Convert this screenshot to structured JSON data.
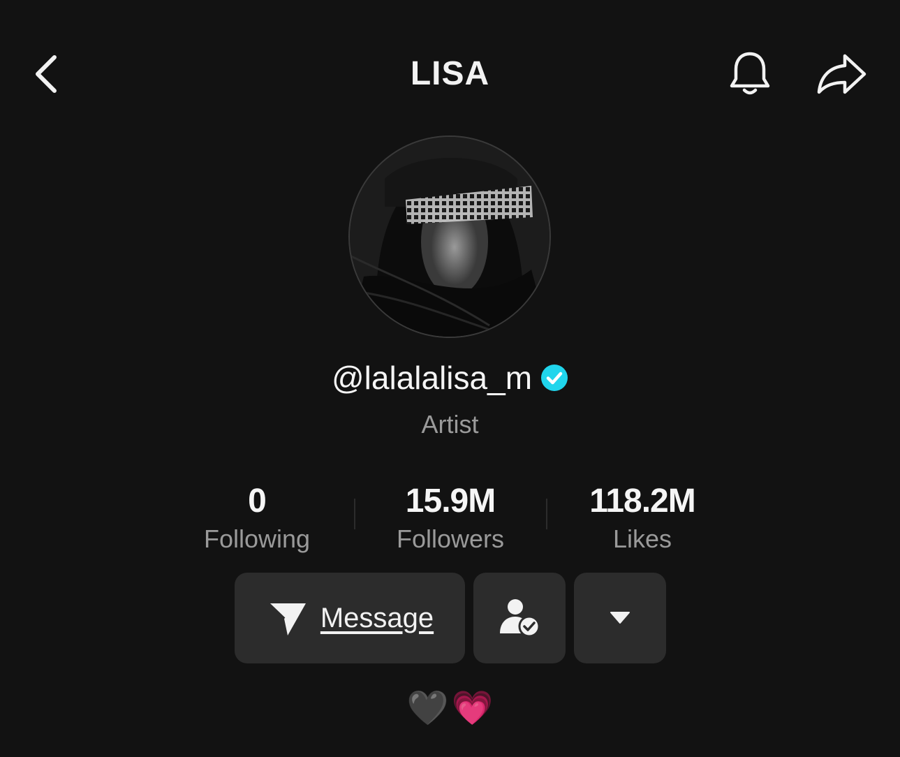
{
  "header": {
    "title": "LISA",
    "back_icon": "chevron-left-icon",
    "bell_icon": "bell-icon",
    "share_icon": "share-arrow-icon"
  },
  "profile": {
    "handle": "@lalalalisa_m",
    "verified": true,
    "verified_color": "#20D5EC",
    "category": "Artist"
  },
  "stats": [
    {
      "value": "0",
      "label": "Following"
    },
    {
      "value": "15.9M",
      "label": "Followers"
    },
    {
      "value": "118.2M",
      "label": "Likes"
    }
  ],
  "actions": {
    "message_label": "Message",
    "message_icon": "paper-plane-icon",
    "friend_icon": "user-check-icon",
    "more_icon": "caret-down-icon"
  },
  "bio": {
    "emoji_1": "🖤",
    "emoji_2": "💗"
  },
  "colors": {
    "background": "#121212",
    "button_bg": "#2C2C2C",
    "text_primary": "#F2F2F2",
    "text_secondary": "#9A9A9A"
  }
}
